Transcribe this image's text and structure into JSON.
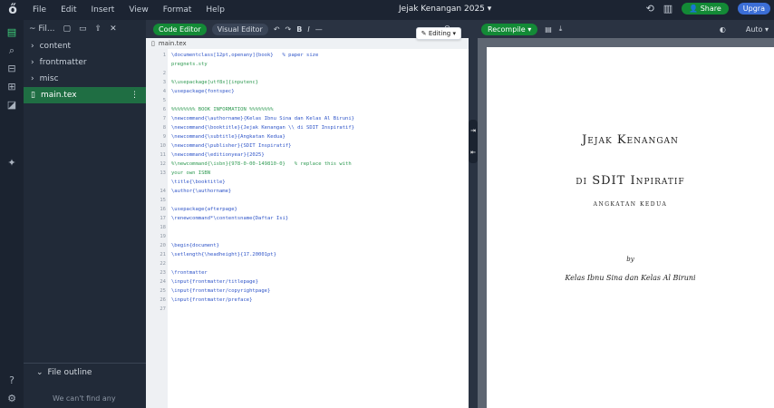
{
  "topbar": {
    "menu": [
      "File",
      "Edit",
      "Insert",
      "View",
      "Format",
      "Help"
    ],
    "project_title": "Jejak Kenangan 2025 ▾",
    "share_label": "Share",
    "upgrade_label": "Upgra"
  },
  "filetree": {
    "toolbar_label": "~ Fil...",
    "items": [
      {
        "label": "content"
      },
      {
        "label": "frontmatter"
      },
      {
        "label": "misc"
      },
      {
        "label": "main.tex"
      }
    ],
    "outline_label": "File outline",
    "outline_message": "We can't find any"
  },
  "editor": {
    "code_editor_label": "Code Editor",
    "visual_editor_label": "Visual Editor",
    "tab_name": "main.tex",
    "editing_label": "Editing ▾",
    "line_numbers": [
      "1",
      "",
      "2",
      "3",
      "4",
      "5",
      "6",
      "7",
      "8",
      "9",
      "10",
      "11",
      "12",
      "13",
      "",
      "14",
      "15",
      "16",
      "17",
      "18",
      "19",
      "20",
      "21",
      "22",
      "23",
      "24",
      "25",
      "26",
      "27"
    ],
    "lines": [
      {
        "text": "\\documentclass[12pt,openany]{book}   % paper size",
        "kind": "cmd"
      },
      {
        "text": "pregnets.sty",
        "kind": "com"
      },
      {
        "text": "",
        "kind": "txt"
      },
      {
        "text": "%\\usepackage[utf8x]{inputenc}",
        "kind": "com"
      },
      {
        "text": "\\usepackage{fontspec}",
        "kind": "cmd"
      },
      {
        "text": "",
        "kind": "txt"
      },
      {
        "text": "%%%%%%%% BOOK INFORMATION %%%%%%%%",
        "kind": "com"
      },
      {
        "text": "\\newcommand{\\authorname}{Kelas Ibnu Sina dan Kelas Al Biruni}",
        "kind": "cmd"
      },
      {
        "text": "\\newcommand{\\booktitle}{Jejak Kenangan \\\\ di SDIT Inspiratif}",
        "kind": "cmd"
      },
      {
        "text": "\\newcommand{\\subtitle}{Angkatan Kedua}",
        "kind": "cmd"
      },
      {
        "text": "\\newcommand{\\publisher}{SDIT Inspiratif}",
        "kind": "cmd"
      },
      {
        "text": "\\newcommand{\\editionyear}{2025}",
        "kind": "cmd"
      },
      {
        "text": "%\\newcommand{\\isbn}{978-0-00-149810-0}   % replace this with",
        "kind": "com"
      },
      {
        "text": "your own ISBN",
        "kind": "com"
      },
      {
        "text": "\\title{\\booktitle}",
        "kind": "cmd"
      },
      {
        "text": "\\author{\\authorname}",
        "kind": "cmd"
      },
      {
        "text": "",
        "kind": "txt"
      },
      {
        "text": "\\usepackage{afterpage}",
        "kind": "cmd"
      },
      {
        "text": "\\renewcommand*\\contentsname{Daftar Isi}",
        "kind": "cmd"
      },
      {
        "text": "",
        "kind": "txt"
      },
      {
        "text": "",
        "kind": "txt"
      },
      {
        "text": "\\begin{document}",
        "kind": "cmd"
      },
      {
        "text": "\\setlength{\\headheight}{17.20001pt}",
        "kind": "cmd"
      },
      {
        "text": "",
        "kind": "txt"
      },
      {
        "text": "\\frontmatter",
        "kind": "cmd"
      },
      {
        "text": "\\input{frontmatter/titlepage}",
        "kind": "cmd"
      },
      {
        "text": "\\input{frontmatter/copyrightpage}",
        "kind": "cmd"
      },
      {
        "text": "\\input{frontmatter/preface}",
        "kind": "cmd"
      },
      {
        "text": "",
        "kind": "txt"
      }
    ]
  },
  "preview": {
    "recompile_label": "Recompile",
    "zoom_label": "Auto ▾",
    "title_line1": "Jejak Kenangan",
    "title_line2": "di SDIT Inpiratif",
    "subtitle": "Angkatan Kedua",
    "by": "by",
    "author": "Kelas Ibnu Sina dan Kelas Al Biruni"
  },
  "colors": {
    "accent": "#138a36",
    "topbar": "#1c2432",
    "editor_bg": "#ffffff"
  }
}
